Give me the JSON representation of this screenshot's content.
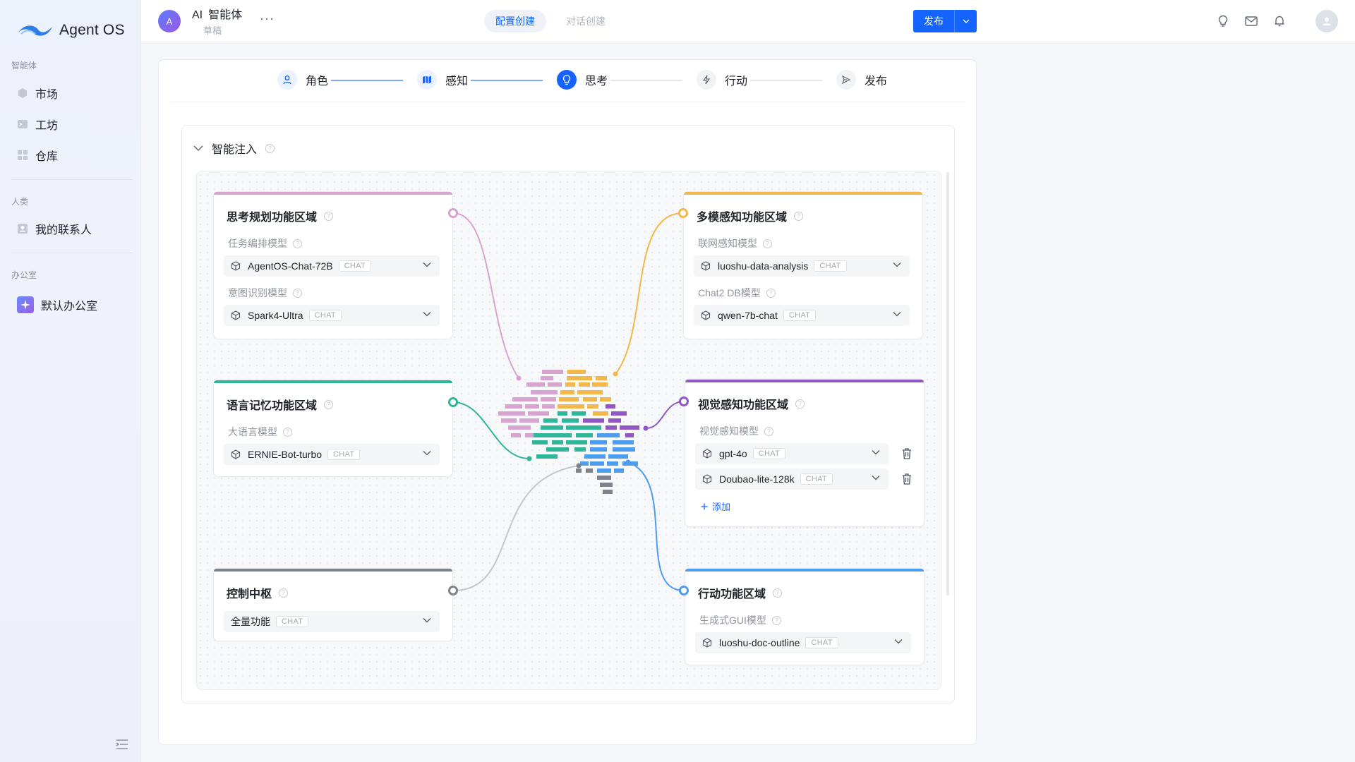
{
  "app": {
    "name": "Agent OS"
  },
  "sidebar": {
    "sections": [
      {
        "label": "智能体",
        "items": [
          {
            "label": "市场"
          },
          {
            "label": "工坊"
          },
          {
            "label": "仓库"
          }
        ]
      },
      {
        "label": "人类",
        "items": [
          {
            "label": "我的联系人"
          }
        ]
      },
      {
        "label": "办公室",
        "items": [
          {
            "label": "默认办公室"
          }
        ]
      }
    ]
  },
  "header": {
    "avatar_letter": "A",
    "title_prefix": "AI",
    "title": "智能体",
    "subtitle": "草稿",
    "more": "···",
    "tabs": [
      {
        "label": "配置创建",
        "active": true
      },
      {
        "label": "对话创建",
        "active": false
      }
    ],
    "publish_label": "发布",
    "accent_color": "#1664ff"
  },
  "steps": [
    {
      "label": "角色",
      "icon": "user-icon",
      "state": "done"
    },
    {
      "label": "感知",
      "icon": "map-icon",
      "state": "done"
    },
    {
      "label": "思考",
      "icon": "bulb-icon",
      "state": "current"
    },
    {
      "label": "行动",
      "icon": "bolt-icon",
      "state": "todo"
    },
    {
      "label": "发布",
      "icon": "send-icon",
      "state": "todo"
    }
  ],
  "inject": {
    "title": "智能注入"
  },
  "areas": {
    "planning": {
      "title": "思考规划功能区域",
      "color": "#d9a3cf",
      "fields": [
        {
          "label": "任务编排模型",
          "value": "AgentOS-Chat-72B",
          "tag": "CHAT"
        },
        {
          "label": "意图识别模型",
          "value": "Spark4-Ultra",
          "tag": "CHAT"
        }
      ]
    },
    "memory": {
      "title": "语言记忆功能区域",
      "color": "#2fb598",
      "fields": [
        {
          "label": "大语言模型",
          "value": "ERNIE-Bot-turbo",
          "tag": "CHAT"
        }
      ]
    },
    "control": {
      "title": "控制中枢",
      "color": "#7d838c",
      "fields": [
        {
          "value": "全量功能",
          "tag": "CHAT"
        }
      ]
    },
    "multimodal": {
      "title": "多模感知功能区域",
      "color": "#f2b84b",
      "fields": [
        {
          "label": "联网感知模型",
          "value": "luoshu-data-analysis",
          "tag": "CHAT"
        },
        {
          "label": "Chat2 DB模型",
          "value": "qwen-7b-chat",
          "tag": "CHAT"
        }
      ]
    },
    "vision": {
      "title": "视觉感知功能区域",
      "color": "#9156c6",
      "label": "视觉感知模型",
      "fields": [
        {
          "value": "gpt-4o",
          "tag": "CHAT"
        },
        {
          "value": "Doubao-lite-128k",
          "tag": "CHAT"
        }
      ],
      "add_label": "添加"
    },
    "action": {
      "title": "行动功能区域",
      "color": "#4c9cf0",
      "fields": [
        {
          "label": "生成式GUI模型",
          "value": "luoshu-doc-outline",
          "tag": "CHAT"
        }
      ]
    }
  }
}
